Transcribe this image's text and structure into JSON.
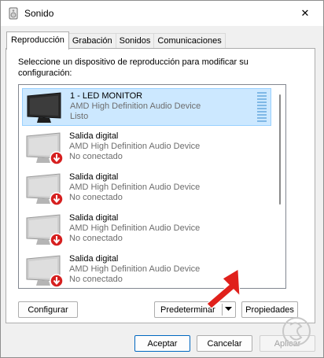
{
  "window": {
    "title": "Sonido",
    "close_glyph": "✕"
  },
  "tabs": [
    {
      "label": "Reproducción",
      "active": true
    },
    {
      "label": "Grabación",
      "active": false
    },
    {
      "label": "Sonidos",
      "active": false
    },
    {
      "label": "Comunicaciones",
      "active": false
    }
  ],
  "instructions": "Seleccione un dispositivo de reproducción para modificar su configuración:",
  "devices": [
    {
      "name": "1 - LED MONITOR",
      "driver": "AMD High Definition Audio Device",
      "status": "Listo",
      "selected": true,
      "disconnected": false,
      "icon": "monitor-icon"
    },
    {
      "name": "Salida digital",
      "driver": "AMD High Definition Audio Device",
      "status": "No conectado",
      "selected": false,
      "disconnected": true,
      "icon": "monitor-disconnected-icon"
    },
    {
      "name": "Salida digital",
      "driver": "AMD High Definition Audio Device",
      "status": "No conectado",
      "selected": false,
      "disconnected": true,
      "icon": "monitor-disconnected-icon"
    },
    {
      "name": "Salida digital",
      "driver": "AMD High Definition Audio Device",
      "status": "No conectado",
      "selected": false,
      "disconnected": true,
      "icon": "monitor-disconnected-icon"
    },
    {
      "name": "Salida digital",
      "driver": "AMD High Definition Audio Device",
      "status": "No conectado",
      "selected": false,
      "disconnected": true,
      "icon": "monitor-disconnected-icon"
    }
  ],
  "panel_buttons": {
    "configure": "Configurar",
    "set_default": "Predeterminar",
    "properties": "Propiedades"
  },
  "dialog_buttons": {
    "ok": "Aceptar",
    "cancel": "Cancelar",
    "apply": "Aplicar"
  },
  "colors": {
    "selection_bg": "#cce8ff",
    "selection_border": "#99d1ff",
    "primary_border": "#0067c0",
    "annotation_arrow": "#e0201b",
    "disconnected_badge": "#d61f1f"
  }
}
